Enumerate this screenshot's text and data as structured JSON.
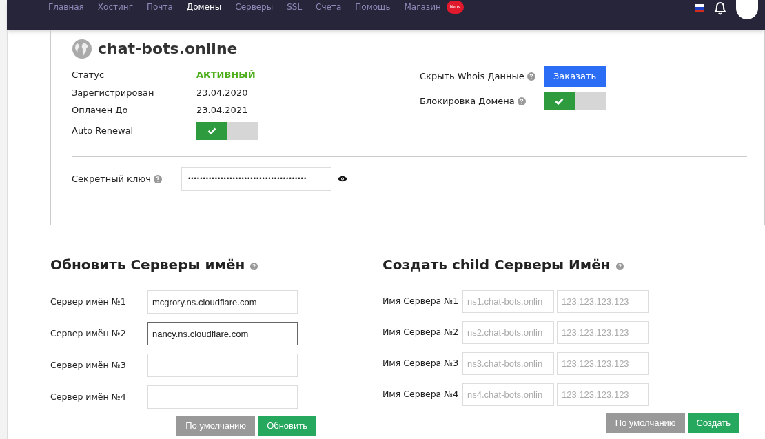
{
  "nav": {
    "items": [
      {
        "label": "Главная",
        "selected": false
      },
      {
        "label": "Хостинг",
        "selected": false
      },
      {
        "label": "Почта",
        "selected": false
      },
      {
        "label": "Домены",
        "selected": true
      },
      {
        "label": "Серверы",
        "selected": false
      },
      {
        "label": "SSL",
        "selected": false
      },
      {
        "label": "Счета",
        "selected": false
      },
      {
        "label": "Помощь",
        "selected": false
      },
      {
        "label": "Магазин",
        "selected": false,
        "badge": "New"
      }
    ]
  },
  "domain": {
    "name": "chat-bots.online",
    "details": [
      {
        "label": "Статус",
        "value": "АКТИВНЫЙ",
        "kind": "status"
      },
      {
        "label": "Зарегистрирован",
        "value": "23.04.2020",
        "kind": "text"
      },
      {
        "label": "Оплачен До",
        "value": "23.04.2021",
        "kind": "text"
      },
      {
        "label": "Auto Renewal",
        "kind": "toggle",
        "checked": true
      }
    ],
    "options": [
      {
        "label": "Скрыть Whois Данные",
        "kind": "button",
        "button": "Заказать"
      },
      {
        "label": "Блокировка Домена",
        "kind": "toggle",
        "checked": true
      }
    ],
    "secret": {
      "label": "Секретный ключ",
      "value": "••••••••••••••••••••••••••••••••••••••••"
    }
  },
  "nameservers": {
    "title": "Обновить Серверы имён",
    "rows": [
      {
        "label": "Сервер имён №1",
        "value": "mcgrory.ns.cloudflare.com",
        "focused": false
      },
      {
        "label": "Сервер имён №2",
        "value": "nancy.ns.cloudflare.com",
        "focused": true
      },
      {
        "label": "Сервер имён №3",
        "focused": false
      },
      {
        "label": "Сервер имён №4",
        "focused": false
      }
    ],
    "buttons": [
      "По умолчанию",
      "Обновить"
    ]
  },
  "child_nameservers": {
    "title": "Создать child Серверы Имён",
    "rows": [
      {
        "label": "Имя Сервера №1",
        "placeholder": "ns1.chat-bots.onlin",
        "ip_placeholder": "123.123.123.123"
      },
      {
        "label": "Имя Сервера №2",
        "placeholder": "ns2.chat-bots.onlin",
        "ip_placeholder": "123.123.123.123"
      },
      {
        "label": "Имя Сервера №3",
        "placeholder": "ns3.chat-bots.onlin",
        "ip_placeholder": "123.123.123.123"
      },
      {
        "label": "Имя Сервера №4",
        "placeholder": "ns4.chat-bots.onlin",
        "ip_placeholder": "123.123.123.123"
      }
    ],
    "buttons": [
      "По умолчанию",
      "Создать"
    ]
  }
}
